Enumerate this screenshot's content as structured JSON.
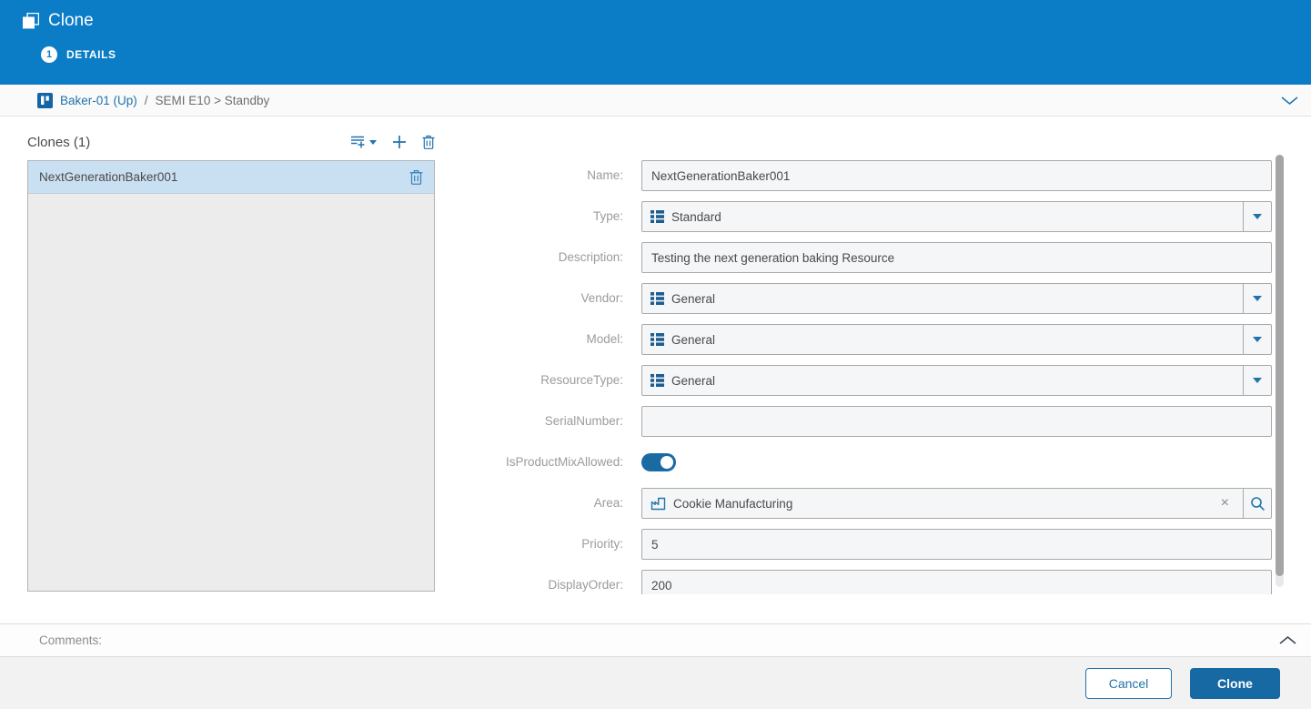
{
  "colors": {
    "header_blue": "#0b7dc6",
    "accent_blue": "#2273aa",
    "primary_button_blue": "#1769a4",
    "selected_item_bg": "#c9e0f2",
    "entity_icon_blue": "#1465a5"
  },
  "header": {
    "title": "Clone",
    "step": {
      "number": "1",
      "label": "DETAILS"
    }
  },
  "breadcrumb": {
    "entity": "Baker-01 (Up)",
    "separator": "/",
    "status": "SEMI E10 > Standby"
  },
  "clones_panel": {
    "title": "Clones (1)",
    "items": [
      {
        "name": "NextGenerationBaker001",
        "selected": true
      }
    ]
  },
  "form": {
    "fields": [
      {
        "label": "Name:",
        "type": "text",
        "value": "NextGenerationBaker001"
      },
      {
        "label": "Type:",
        "type": "dropdown",
        "value": "Standard"
      },
      {
        "label": "Description:",
        "type": "text",
        "value": "Testing the next generation baking Resource"
      },
      {
        "label": "Vendor:",
        "type": "dropdown",
        "value": "General"
      },
      {
        "label": "Model:",
        "type": "dropdown",
        "value": "General"
      },
      {
        "label": "ResourceType:",
        "type": "dropdown",
        "value": "General"
      },
      {
        "label": "SerialNumber:",
        "type": "text",
        "value": ""
      },
      {
        "label": "IsProductMixAllowed:",
        "type": "toggle",
        "value": "on"
      },
      {
        "label": "Area:",
        "type": "lookup",
        "value": "Cookie Manufacturing"
      },
      {
        "label": "Priority:",
        "type": "text",
        "value": "5"
      },
      {
        "label": "DisplayOrder:",
        "type": "text",
        "value": "200"
      }
    ]
  },
  "comments": {
    "label": "Comments:"
  },
  "footer": {
    "cancel_label": "Cancel",
    "clone_label": "Clone"
  },
  "icons": {
    "clear": "×"
  }
}
